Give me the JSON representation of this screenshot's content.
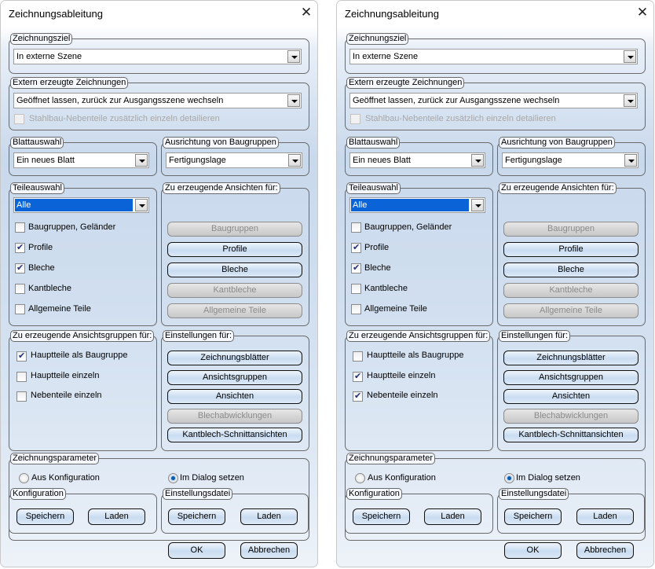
{
  "dialogs": [
    {
      "title": "Zeichnungsableitung",
      "target": {
        "legend": "Zeichnungsziel",
        "value": "In externe Szene"
      },
      "external": {
        "legend": "Extern erzeugte Zeichnungen",
        "value": "Geöffnet lassen, zurück zur Ausgangsszene wechseln",
        "checkbox_label": "Stahlbau-Nebenteile zusätzlich einzeln detailieren",
        "checked": false,
        "disabled": true
      },
      "sheet": {
        "legend": "Blattauswahl",
        "value": "Ein neues Blatt"
      },
      "orientation": {
        "legend": "Ausrichtung von Baugruppen",
        "value": "Fertigungslage"
      },
      "parts": {
        "legend": "Teileauswahl",
        "value": "Alle",
        "items": [
          {
            "label": "Baugruppen, Geländer",
            "checked": false
          },
          {
            "label": "Profile",
            "checked": true
          },
          {
            "label": "Bleche",
            "checked": true
          },
          {
            "label": "Kantbleche",
            "checked": false
          },
          {
            "label": "Allgemeine Teile",
            "checked": false
          }
        ]
      },
      "views": {
        "legend": "Zu erzeugende Ansichten für:",
        "buttons": [
          {
            "label": "Baugruppen",
            "enabled": false
          },
          {
            "label": "Profile",
            "enabled": true
          },
          {
            "label": "Bleche",
            "enabled": true
          },
          {
            "label": "Kantbleche",
            "enabled": false
          },
          {
            "label": "Allgemeine Teile",
            "enabled": false
          }
        ]
      },
      "viewgroups": {
        "legend": "Zu erzeugende Ansichtsgruppen für:",
        "items": [
          {
            "label": "Hauptteile als Baugruppe",
            "checked": true
          },
          {
            "label": "Hauptteile einzeln",
            "checked": false
          },
          {
            "label": "Nebenteile einzeln",
            "checked": false
          }
        ]
      },
      "settings": {
        "legend": "Einstellungen für:",
        "buttons": [
          {
            "label": "Zeichnungsblätter",
            "enabled": true
          },
          {
            "label": "Ansichtsgruppen",
            "enabled": true
          },
          {
            "label": "Ansichten",
            "enabled": true
          },
          {
            "label": "Blechabwicklungen",
            "enabled": false
          },
          {
            "label": "Kantblech-Schnittansichten",
            "enabled": true
          }
        ]
      },
      "params": {
        "legend": "Zeichnungsparameter",
        "radio_config": "Aus Konfiguration",
        "radio_dialog": "Im Dialog setzen",
        "selected": "dialog",
        "config": {
          "legend": "Konfiguration",
          "save": "Speichern",
          "load": "Laden"
        },
        "file": {
          "legend": "Einstellungsdatei",
          "save": "Speichern",
          "load": "Laden"
        }
      },
      "ok": "OK",
      "cancel": "Abbrechen"
    },
    {
      "title": "Zeichnungsableitung",
      "target": {
        "legend": "Zeichnungsziel",
        "value": "In externe Szene"
      },
      "external": {
        "legend": "Extern erzeugte Zeichnungen",
        "value": "Geöffnet lassen, zurück zur Ausgangsszene wechseln",
        "checkbox_label": "Stahlbau-Nebenteile zusätzlich einzeln detailieren",
        "checked": false,
        "disabled": true
      },
      "sheet": {
        "legend": "Blattauswahl",
        "value": "Ein neues Blatt"
      },
      "orientation": {
        "legend": "Ausrichtung von Baugruppen",
        "value": "Fertigungslage"
      },
      "parts": {
        "legend": "Teileauswahl",
        "value": "Alle",
        "items": [
          {
            "label": "Baugruppen, Geländer",
            "checked": false
          },
          {
            "label": "Profile",
            "checked": true
          },
          {
            "label": "Bleche",
            "checked": true
          },
          {
            "label": "Kantbleche",
            "checked": false
          },
          {
            "label": "Allgemeine Teile",
            "checked": false
          }
        ]
      },
      "views": {
        "legend": "Zu erzeugende Ansichten für:",
        "buttons": [
          {
            "label": "Baugruppen",
            "enabled": false
          },
          {
            "label": "Profile",
            "enabled": true
          },
          {
            "label": "Bleche",
            "enabled": true
          },
          {
            "label": "Kantbleche",
            "enabled": false
          },
          {
            "label": "Allgemeine Teile",
            "enabled": false
          }
        ]
      },
      "viewgroups": {
        "legend": "Zu erzeugende Ansichtsgruppen für:",
        "items": [
          {
            "label": "Hauptteile als Baugruppe",
            "checked": false
          },
          {
            "label": "Hauptteile einzeln",
            "checked": true
          },
          {
            "label": "Nebenteile einzeln",
            "checked": true
          }
        ]
      },
      "settings": {
        "legend": "Einstellungen für:",
        "buttons": [
          {
            "label": "Zeichnungsblätter",
            "enabled": true
          },
          {
            "label": "Ansichtsgruppen",
            "enabled": true
          },
          {
            "label": "Ansichten",
            "enabled": true
          },
          {
            "label": "Blechabwicklungen",
            "enabled": false
          },
          {
            "label": "Kantblech-Schnittansichten",
            "enabled": true
          }
        ]
      },
      "params": {
        "legend": "Zeichnungsparameter",
        "radio_config": "Aus Konfiguration",
        "radio_dialog": "Im Dialog setzen",
        "selected": "dialog",
        "config": {
          "legend": "Konfiguration",
          "save": "Speichern",
          "load": "Laden"
        },
        "file": {
          "legend": "Einstellungsdatei",
          "save": "Speichern",
          "load": "Laden"
        }
      },
      "ok": "OK",
      "cancel": "Abbrechen"
    }
  ]
}
